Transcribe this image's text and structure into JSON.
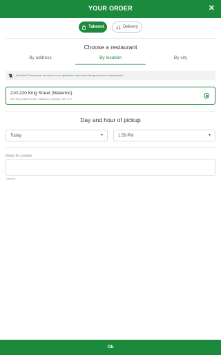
{
  "header": {
    "title": "YOUR ORDER",
    "close_symbol": "✕"
  },
  "order_mode": {
    "takeout_label": "Takeout",
    "delivery_label": "Delivery",
    "selected": "takeout"
  },
  "restaurant_section": {
    "title": "Choose a restaurant",
    "tabs": [
      {
        "label": "By address"
      },
      {
        "label": "By location",
        "active": true
      },
      {
        "label": "By city"
      }
    ],
    "notice": "Attention! Restaurants are shown in an alphabetic order since the geolocation is deactivated",
    "restaurants": [
      {
        "name": "210-220 King Street (Waterloo)",
        "address": "220 King Street North, Waterloo, Ontario, N2J 2Y7",
        "selected": true
      }
    ]
  },
  "pickup_section": {
    "title": "Day and hour of pickup",
    "day_value": "Today",
    "time_value": "1:59 PM"
  },
  "notes": {
    "label": "Notes for counter",
    "hint": "Optional"
  },
  "footer": {
    "ok_label": "Ok"
  },
  "colors": {
    "brand_green": "#1c8a3c",
    "notice_bg": "#f1f2f2"
  },
  "icons": {
    "close": "close-icon",
    "takeout": "bag-icon",
    "delivery": "scooter-icon",
    "notice": "location-off-icon",
    "select_caret": "caret-down-icon"
  }
}
